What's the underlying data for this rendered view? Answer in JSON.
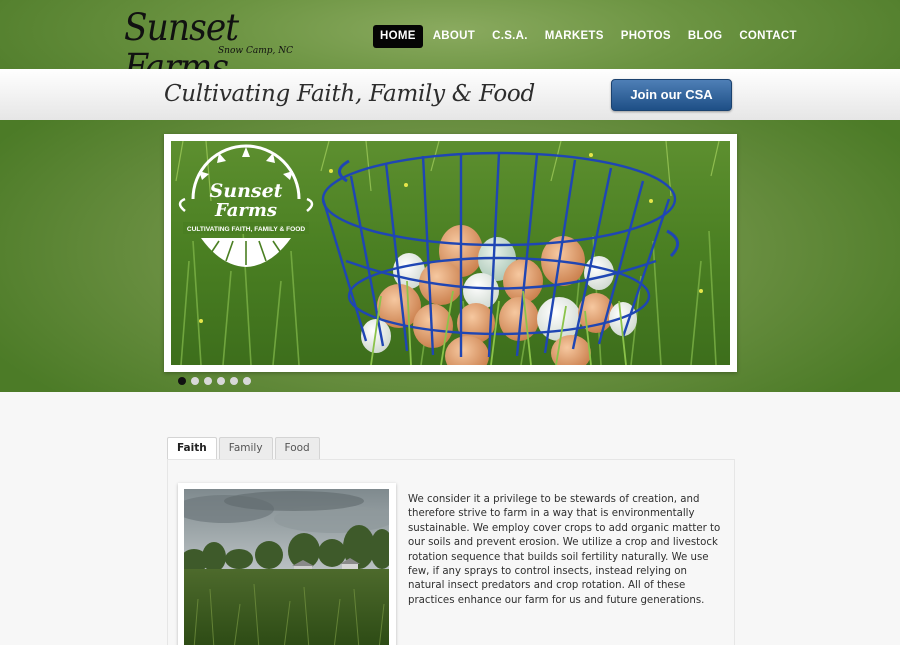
{
  "site": {
    "title": "Sunset Farms",
    "subtitle": "Snow Camp, NC"
  },
  "nav": {
    "items": [
      {
        "label": "HOME",
        "active": true
      },
      {
        "label": "ABOUT",
        "active": false
      },
      {
        "label": "C.S.A.",
        "active": false
      },
      {
        "label": "MARKETS",
        "active": false
      },
      {
        "label": "PHOTOS",
        "active": false
      },
      {
        "label": "BLOG",
        "active": false
      },
      {
        "label": "CONTACT",
        "active": false
      }
    ]
  },
  "tagband": {
    "tagline": "Cultivating Faith, Family & Food",
    "cta_label": "Join our CSA"
  },
  "hero": {
    "badge_title_1": "Sunset",
    "badge_title_2": "Farms",
    "badge_tagline": "CULTIVATING FAITH, FAMILY & FOOD",
    "slide_count": 6,
    "active_slide": 1
  },
  "tabs": [
    {
      "label": "Faith",
      "active": true
    },
    {
      "label": "Family",
      "active": false
    },
    {
      "label": "Food",
      "active": false
    }
  ],
  "content": {
    "faith_text": "We consider it a privilege to be stewards of creation, and therefore strive to farm in a way that is environmentally sustainable. We employ cover crops to add organic matter to our soils and prevent erosion. We utilize a crop and livestock rotation sequence that builds soil fertility naturally. We use few, if any sprays to control insects, instead relying on natural insect predators and crop rotation. All of these practices enhance our farm for us and future generations."
  },
  "colors": {
    "header_green": "#5f8a36",
    "cta_blue": "#2a5c93",
    "nav_active": "#050505"
  }
}
